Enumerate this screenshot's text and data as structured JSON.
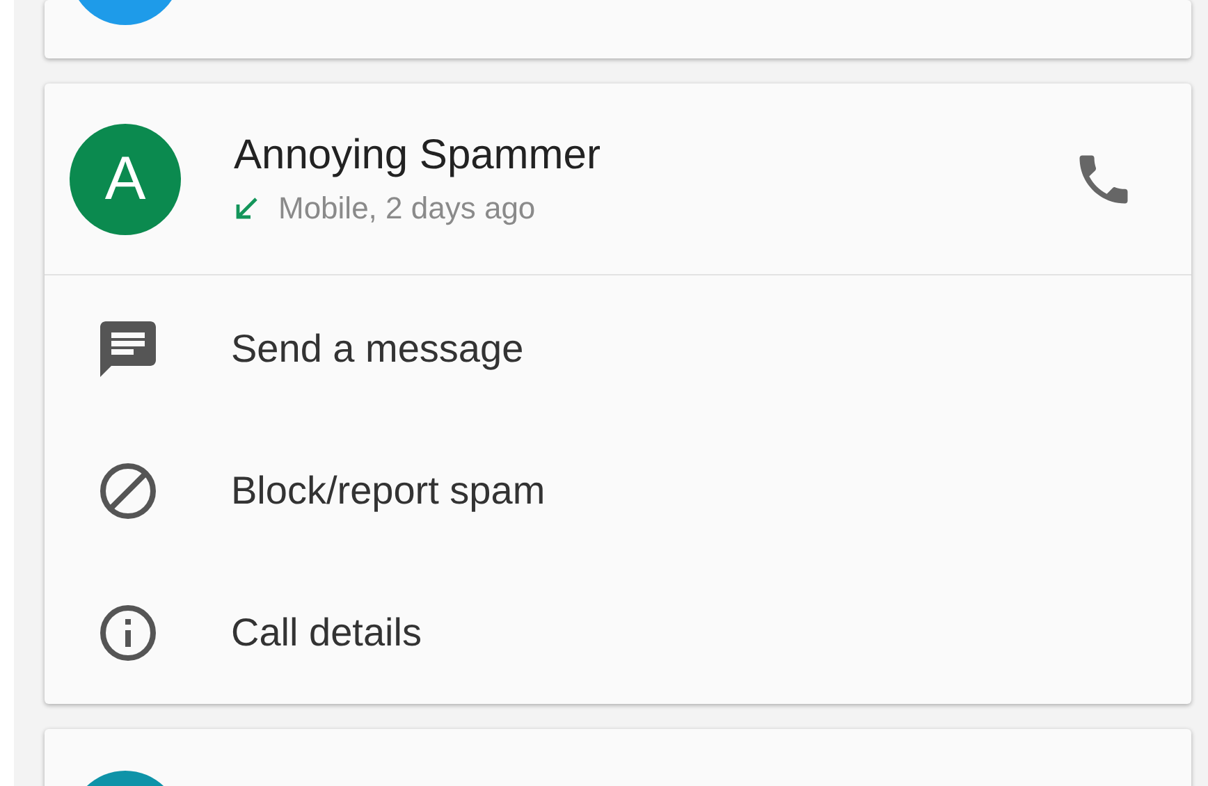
{
  "calls": [
    {
      "kind": "partial-top",
      "color": "#1e9be9"
    },
    {
      "kind": "expanded",
      "color": "#0b8a4f",
      "initial": "A",
      "name": "Annoying Spammer",
      "detail": "Mobile, 2 days ago",
      "actions": [
        {
          "kind": "message",
          "label": "Send a message"
        },
        {
          "kind": "block",
          "label": "Block/report spam"
        },
        {
          "kind": "info",
          "label": "Call details"
        }
      ]
    },
    {
      "kind": "partial-bottom",
      "color": "#0e93a8"
    }
  ]
}
